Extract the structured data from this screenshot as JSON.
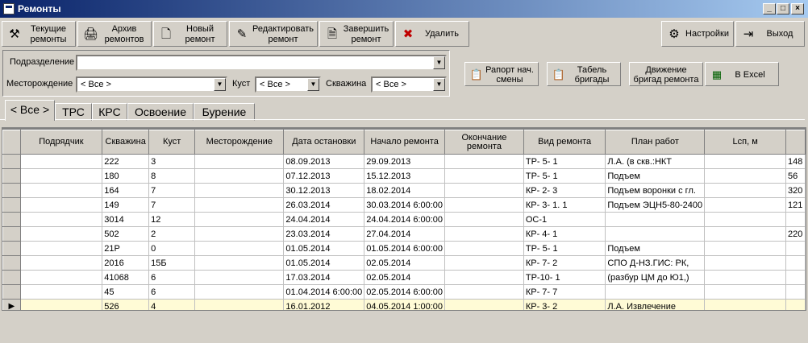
{
  "window": {
    "title": "Ремонты"
  },
  "toolbar": {
    "current": [
      "Текущие",
      "ремонты"
    ],
    "archive": [
      "Архив",
      "ремонтов"
    ],
    "new": [
      "Новый",
      "ремонт"
    ],
    "edit": [
      "Редактировать",
      "ремонт"
    ],
    "finish": [
      "Завершить",
      "ремонт"
    ],
    "delete": "Удалить",
    "settings": "Настройки",
    "exit": "Выход"
  },
  "filters": {
    "division_label": "Подразделение",
    "division_value": "",
    "field_label": "Месторождение",
    "field_value": "< Все >",
    "cluster_label": "Куст",
    "cluster_value": "< Все >",
    "well_label": "Скважина",
    "well_value": "< Все >"
  },
  "reports": {
    "raport": [
      "Рапорт нач.",
      "смены"
    ],
    "tabel": [
      "Табель",
      "бригады"
    ],
    "movement": [
      "Движение",
      "бригад ремонта"
    ],
    "excel": "В Excel"
  },
  "tabs": [
    "< Все >",
    "ТРС",
    "КРС",
    "Освоение",
    "Бурение"
  ],
  "table": {
    "columns": [
      "Подрядчик",
      "Скважина",
      "Куст",
      "Месторождение",
      "Дата остановки",
      "Начало ремонта",
      "Окончание ремонта",
      "Вид ремонта",
      "План работ",
      "Lсп, м",
      ""
    ],
    "rows": [
      [
        "",
        "222",
        "3",
        "",
        "08.09.2013",
        "29.09.2013",
        "",
        "ТР- 5- 1",
        "Л.А. (в скв.:НКТ",
        "",
        "148"
      ],
      [
        "",
        "180",
        "8",
        "",
        "07.12.2013",
        "15.12.2013",
        "",
        "ТР- 5- 1",
        "Подъем",
        "",
        "56"
      ],
      [
        "",
        "164",
        "7",
        "",
        "30.12.2013",
        "18.02.2014",
        "",
        "КР- 2- 3",
        "Подъем воронки с гл.",
        "",
        "320"
      ],
      [
        "",
        "149",
        "7",
        "",
        "26.03.2014",
        "30.03.2014 6:00:00",
        "",
        "КР- 3- 1. 1",
        "Подъем ЭЦН5-80-2400",
        "",
        "121"
      ],
      [
        "",
        "3014",
        "12",
        "",
        "24.04.2014",
        "24.04.2014 6:00:00",
        "",
        "ОС-1",
        "",
        "",
        ""
      ],
      [
        "",
        "502",
        "2",
        "",
        "23.03.2014",
        "27.04.2014",
        "",
        "КР- 4- 1",
        "",
        "",
        "220"
      ],
      [
        "",
        "21Р",
        "0",
        "",
        "01.05.2014",
        "01.05.2014 6:00:00",
        "",
        "ТР- 5- 1",
        "Подъем",
        "",
        ""
      ],
      [
        "",
        "2016",
        "15Б",
        "",
        "01.05.2014",
        "02.05.2014",
        "",
        "КР- 7- 2",
        "СПО Д-НЗ.ГИС: РК,",
        "",
        ""
      ],
      [
        "",
        "41068",
        "6",
        "",
        "17.03.2014",
        "02.05.2014",
        "",
        "ТР-10- 1",
        "(разбур ЦМ до Ю1,)",
        "",
        ""
      ],
      [
        "",
        "45",
        "6",
        "",
        "01.04.2014 6:00:00",
        "02.05.2014 6:00:00",
        "",
        "КР- 7- 7",
        "",
        "",
        ""
      ],
      [
        "",
        "526",
        "4",
        "",
        "16.01.2012",
        "04.05.2014 1:00:00",
        "",
        "КР- 3- 2",
        "Л.А. Извлечение",
        "",
        ""
      ]
    ],
    "selected_row": 10
  }
}
